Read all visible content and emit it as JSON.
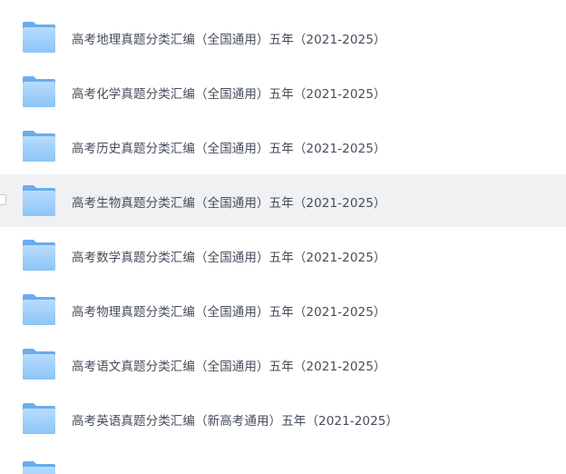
{
  "files": [
    {
      "name": "高考地理真题分类汇编（全国通用）五年（2021-2025）",
      "icon": "folder-icon"
    },
    {
      "name": "高考化学真题分类汇编（全国通用）五年（2021-2025）",
      "icon": "folder-icon"
    },
    {
      "name": "高考历史真题分类汇编（全国通用）五年（2021-2025）",
      "icon": "folder-icon"
    },
    {
      "name": "高考生物真题分类汇编（全国通用）五年（2021-2025）",
      "icon": "folder-icon",
      "hovered": true
    },
    {
      "name": "高考数学真题分类汇编（全国通用）五年（2021-2025）",
      "icon": "folder-icon"
    },
    {
      "name": "高考物理真题分类汇编（全国通用）五年（2021-2025）",
      "icon": "folder-icon"
    },
    {
      "name": "高考语文真题分类汇编（全国通用）五年（2021-2025）",
      "icon": "folder-icon"
    },
    {
      "name": "高考英语真题分类汇编（新高考通用）五年（2021-2025）",
      "icon": "folder-icon"
    }
  ],
  "colors": {
    "hover_background": "#f0f1f3",
    "text": "#454d5a",
    "folder_light": "#a9d4fb",
    "folder_dark": "#6fb2f2"
  }
}
